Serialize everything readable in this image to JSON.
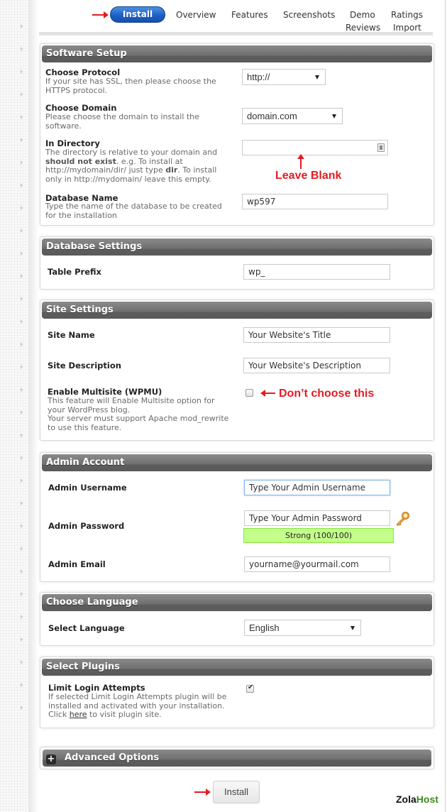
{
  "nav": {
    "install_tab": "Install",
    "tabs": [
      "Overview",
      "Features",
      "Screenshots",
      "Demo",
      "Ratings",
      "Reviews",
      "Import"
    ]
  },
  "software_setup": {
    "title": "Software Setup",
    "protocol": {
      "label": "Choose Protocol",
      "description": "If your site has SSL, then please choose the HTTPS protocol.",
      "value": "http://"
    },
    "domain": {
      "label": "Choose Domain",
      "description": "Please choose the domain to install the software.",
      "value": "domain.com"
    },
    "directory": {
      "label": "In Directory",
      "desc_1": "The directory is relative to your domain and ",
      "desc_bold_1": "should not exist",
      "desc_2": ". e.g. To install at http://mydomain/dir/ just type ",
      "desc_bold_2": "dir",
      "desc_3": ". To install only in http://mydomain/ leave this empty.",
      "value": "",
      "annotation": "Leave Blank"
    },
    "database_name": {
      "label": "Database Name",
      "description": "Type the name of the database to be created for the installation",
      "value": "wp597"
    }
  },
  "database_settings": {
    "title": "Database Settings",
    "table_prefix": {
      "label": "Table Prefix",
      "value": "wp_"
    }
  },
  "site_settings": {
    "title": "Site Settings",
    "site_name": {
      "label": "Site Name",
      "value": "Your Website's Title"
    },
    "site_description": {
      "label": "Site Description",
      "value": "Your Website's Description"
    },
    "multisite": {
      "label": "Enable Multisite (WPMU)",
      "description_1": "This feature will Enable Multisite option for your WordPress blog.",
      "description_2": "Your server must support Apache mod_rewrite to use this feature.",
      "checked": false,
      "annotation": "Don’t choose this"
    }
  },
  "admin_account": {
    "title": "Admin Account",
    "username": {
      "label": "Admin Username",
      "value": "Type Your Admin Username"
    },
    "password": {
      "label": "Admin Password",
      "value": "Type Your Admin Password",
      "strength": "Strong (100/100)",
      "strength_score": 100,
      "strength_color": "#c3ff8a"
    },
    "email": {
      "label": "Admin Email",
      "value": "yourname@yourmail.com"
    }
  },
  "choose_language": {
    "title": "Choose Language",
    "language": {
      "label": "Select Language",
      "value": "English"
    }
  },
  "select_plugins": {
    "title": "Select Plugins",
    "limit_login": {
      "label": "Limit Login Attempts",
      "description": "If selected Limit Login Attempts plugin will be installed and activated with your installation.",
      "click_prefix": "Click ",
      "link_text": "here",
      "click_suffix": " to visit plugin site.",
      "checked": true
    }
  },
  "advanced": {
    "title": "Advanced Options",
    "icon": "+"
  },
  "install_button": "Install",
  "brand": {
    "part1": "Zola",
    "part2": "Host"
  },
  "colors": {
    "accent": "#1e5fc4",
    "annotation": "#e31b23",
    "header": "#6f6f6f"
  }
}
